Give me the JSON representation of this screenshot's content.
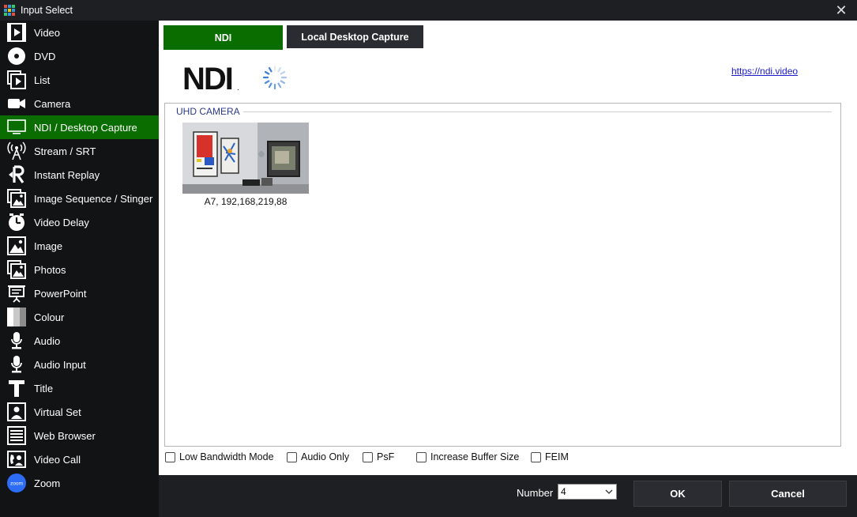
{
  "window": {
    "title": "Input Select",
    "close_glyph": "✕"
  },
  "sidebar": {
    "items": [
      {
        "label": "Video",
        "icon": "video-file-icon"
      },
      {
        "label": "DVD",
        "icon": "disc-icon"
      },
      {
        "label": "List",
        "icon": "list-icon"
      },
      {
        "label": "Camera",
        "icon": "camera-icon"
      },
      {
        "label": "NDI / Desktop Capture",
        "icon": "monitor-icon",
        "active": true
      },
      {
        "label": "Stream / SRT",
        "icon": "antenna-icon"
      },
      {
        "label": "Instant Replay",
        "icon": "replay-icon"
      },
      {
        "label": "Image Sequence / Stinger",
        "icon": "image-sequence-icon"
      },
      {
        "label": "Video Delay",
        "icon": "clock-icon"
      },
      {
        "label": "Image",
        "icon": "image-icon"
      },
      {
        "label": "Photos",
        "icon": "photos-icon"
      },
      {
        "label": "PowerPoint",
        "icon": "presentation-icon"
      },
      {
        "label": "Colour",
        "icon": "colour-icon"
      },
      {
        "label": "Audio",
        "icon": "microphone-icon"
      },
      {
        "label": "Audio Input",
        "icon": "microphone-input-icon"
      },
      {
        "label": "Title",
        "icon": "title-icon"
      },
      {
        "label": "Virtual Set",
        "icon": "virtual-set-icon"
      },
      {
        "label": "Web Browser",
        "icon": "web-browser-icon"
      },
      {
        "label": "Video Call",
        "icon": "video-call-icon"
      },
      {
        "label": "Zoom",
        "icon": "zoom-icon",
        "icon_text": "zoom"
      }
    ]
  },
  "tabs": [
    {
      "label": "NDI",
      "active": true
    },
    {
      "label": "Local Desktop Capture",
      "active": false
    }
  ],
  "ndi": {
    "logo_text": "NDI",
    "logo_mark": ".",
    "link": "https://ndi.video",
    "group_title": "UHD CAMERA",
    "source_caption": "A7, 192,168,219,88"
  },
  "options": [
    {
      "label": "Low Bandwidth Mode",
      "checked": false
    },
    {
      "label": "Audio Only",
      "checked": false
    },
    {
      "label": "PsF",
      "checked": false
    },
    {
      "label": "Increase Buffer Size",
      "checked": false
    },
    {
      "label": "FEIM",
      "checked": false
    }
  ],
  "footer": {
    "number_label": "Number",
    "number_value": "4",
    "ok_label": "OK",
    "cancel_label": "Cancel"
  },
  "colors": {
    "active_green": "#0a6d00",
    "window_bg": "#1e1f22",
    "sidebar_bg": "#121315",
    "button_bg": "#2a2c31",
    "link": "#1a1acc",
    "group_title": "#2b3a8a"
  }
}
